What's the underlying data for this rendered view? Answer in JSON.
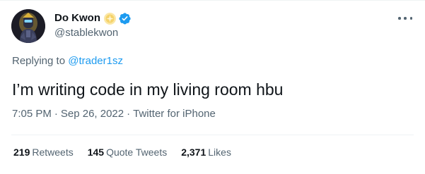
{
  "author": {
    "display_name": "Do Kwon",
    "handle": "@stablekwon",
    "avatar_icon": "profile-avatar",
    "affiliate_badge_icon": "moon-badge-icon",
    "verified_icon": "verified-badge-icon"
  },
  "more_icon": "more-horizontal-icon",
  "reply_context": {
    "prefix": "Replying to ",
    "mention": "@trader1sz"
  },
  "tweet": {
    "text": "I’m writing code in my living room hbu",
    "time": "7:05 PM",
    "separator": "·",
    "date": "Sep 26, 2022",
    "source": "Twitter for iPhone"
  },
  "stats": {
    "retweets_count": "219",
    "retweets_label": "Retweets",
    "quote_tweets_count": "145",
    "quote_tweets_label": "Quote Tweets",
    "likes_count": "2,371",
    "likes_label": "Likes"
  },
  "colors": {
    "accent": "#1d9bf0",
    "secondary_text": "#536471",
    "primary_text": "#0f1419",
    "badge_gold": "#f5d36b"
  }
}
